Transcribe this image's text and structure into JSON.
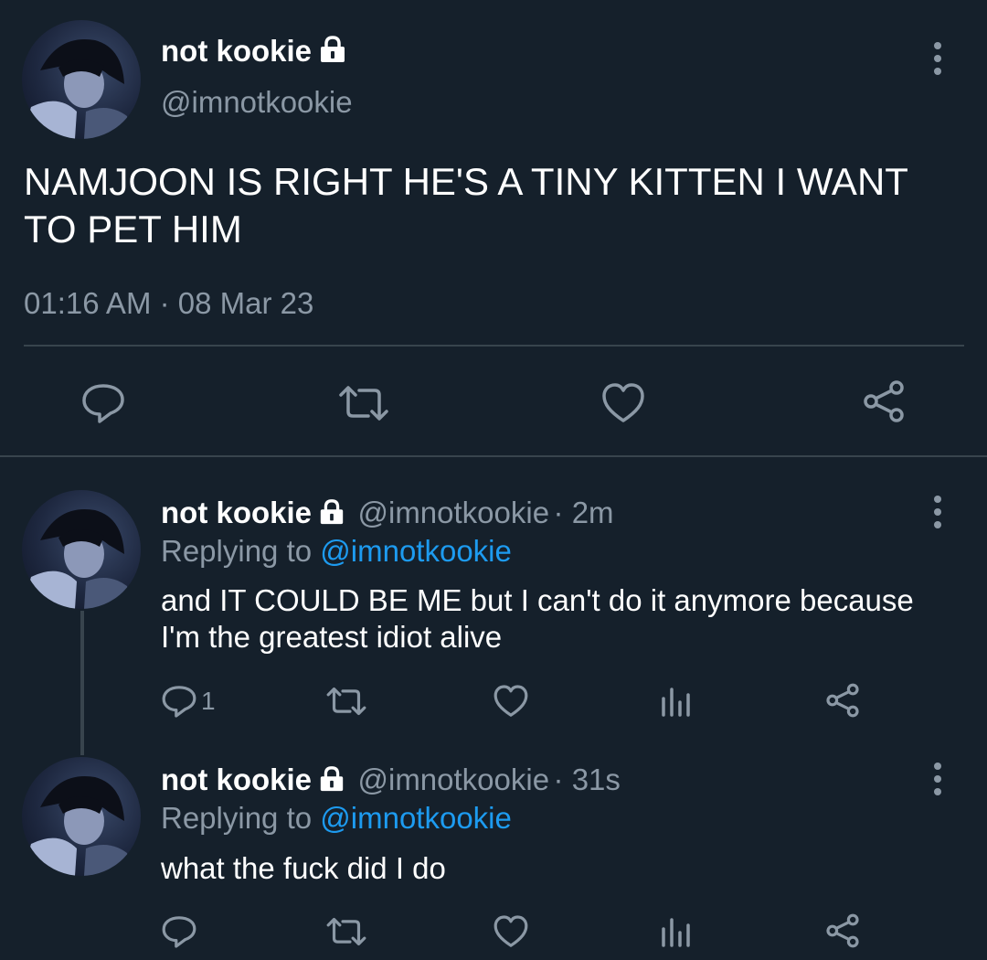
{
  "main_tweet": {
    "name": "not kookie",
    "handle": "@imnotkookie",
    "text": "NAMJOON IS RIGHT HE'S A TINY KITTEN I WANT TO PET HIM",
    "timestamp": "01:16 AM · 08 Mar 23",
    "actions": [
      "reply-icon",
      "retweet-icon",
      "like-icon",
      "share-icon"
    ]
  },
  "replies": [
    {
      "name": "not kookie",
      "handle": "@imnotkookie",
      "sep_time": "· 2m",
      "replying_prefix": "Replying to",
      "replying_to": "@imnotkookie",
      "text": "and IT COULD BE ME but I can't do it anymore because I'm the greatest idiot alive",
      "reply_count": "1"
    },
    {
      "name": "not kookie",
      "handle": "@imnotkookie",
      "sep_time": "· 31s",
      "replying_prefix": "Replying to",
      "replying_to": "@imnotkookie",
      "text": "what the fuck did I do",
      "reply_count": ""
    }
  ],
  "colors": {
    "background": "#15202b",
    "text": "#ffffff",
    "secondary": "#8b98a5",
    "link": "#1d9bf0",
    "divider": "#38444d"
  }
}
